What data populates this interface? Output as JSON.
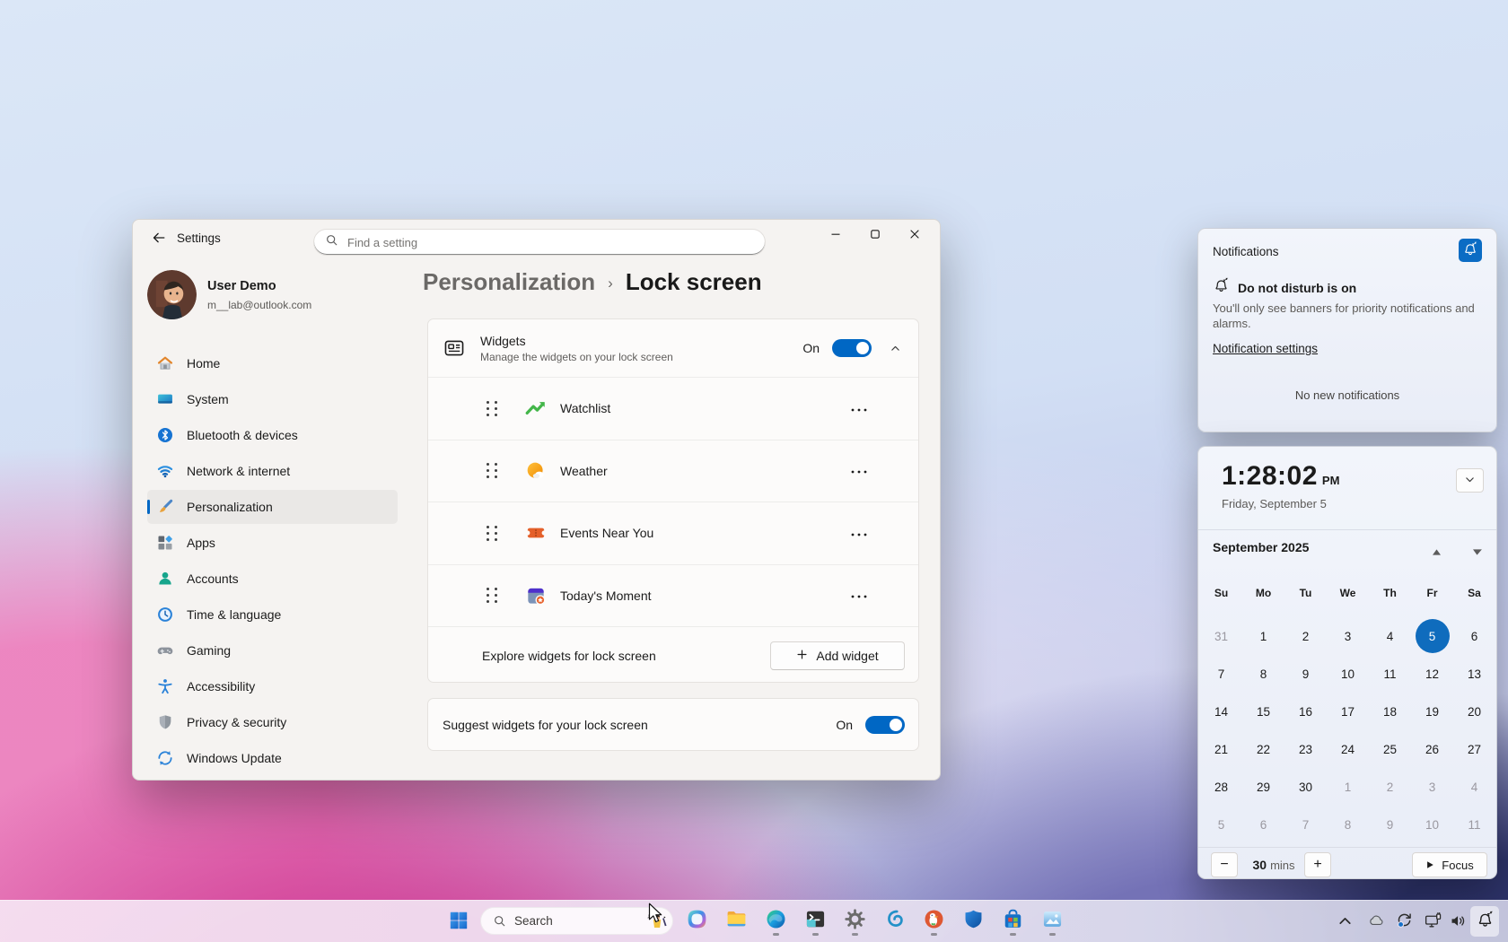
{
  "accent": "#0067c4",
  "settings_window": {
    "title": "Settings",
    "search_placeholder": "Find a setting",
    "window_controls": [
      {
        "name": "minimize-button",
        "icon": "minimize"
      },
      {
        "name": "maximize-button",
        "icon": "maximize"
      },
      {
        "name": "close-button",
        "icon": "close"
      }
    ],
    "user": {
      "name": "User Demo",
      "email": "m__lab@outlook.com"
    },
    "sidebar": [
      {
        "label": "Home",
        "icon": "home-icon"
      },
      {
        "label": "System",
        "icon": "system-icon"
      },
      {
        "label": "Bluetooth & devices",
        "icon": "bluetooth-icon"
      },
      {
        "label": "Network & internet",
        "icon": "network-icon"
      },
      {
        "label": "Personalization",
        "icon": "personalization-icon",
        "selected": true
      },
      {
        "label": "Apps",
        "icon": "apps-icon"
      },
      {
        "label": "Accounts",
        "icon": "accounts-icon"
      },
      {
        "label": "Time & language",
        "icon": "time-language-icon"
      },
      {
        "label": "Gaming",
        "icon": "gaming-icon"
      },
      {
        "label": "Accessibility",
        "icon": "accessibility-icon"
      },
      {
        "label": "Privacy & security",
        "icon": "privacy-icon"
      },
      {
        "label": "Windows Update",
        "icon": "windows-update-icon"
      }
    ],
    "breadcrumb": {
      "parent": "Personalization",
      "separator": "›",
      "current": "Lock screen"
    },
    "widgets": {
      "title": "Widgets",
      "subtitle": "Manage the widgets on your lock screen",
      "state": "On",
      "items": [
        {
          "label": "Watchlist",
          "icon": "watchlist-icon"
        },
        {
          "label": "Weather",
          "icon": "weather-icon"
        },
        {
          "label": "Events Near You",
          "icon": "events-icon"
        },
        {
          "label": "Today's Moment",
          "icon": "todays-moment-icon"
        }
      ],
      "explore_label": "Explore widgets for lock screen",
      "add_widget_label": "Add widget"
    },
    "suggest": {
      "label": "Suggest widgets for your lock screen",
      "state": "On"
    }
  },
  "notifications_panel": {
    "title": "Notifications",
    "dnd_title": "Do not disturb is on",
    "dnd_body": "You'll only see banners for priority notifications and alarms.",
    "settings_link": "Notification settings",
    "empty": "No new notifications"
  },
  "clock_panel": {
    "time": "1:28:02",
    "meridiem": "PM",
    "date": "Friday, September 5"
  },
  "calendar": {
    "month_label": "September 2025",
    "day_headers": [
      "Su",
      "Mo",
      "Tu",
      "We",
      "Th",
      "Fr",
      "Sa"
    ],
    "cells": [
      {
        "d": "31",
        "muted": true
      },
      {
        "d": "1"
      },
      {
        "d": "2"
      },
      {
        "d": "3"
      },
      {
        "d": "4"
      },
      {
        "d": "5",
        "selected": true
      },
      {
        "d": "6"
      },
      {
        "d": "7"
      },
      {
        "d": "8"
      },
      {
        "d": "9"
      },
      {
        "d": "10"
      },
      {
        "d": "11"
      },
      {
        "d": "12"
      },
      {
        "d": "13"
      },
      {
        "d": "14"
      },
      {
        "d": "15"
      },
      {
        "d": "16"
      },
      {
        "d": "17"
      },
      {
        "d": "18"
      },
      {
        "d": "19"
      },
      {
        "d": "20"
      },
      {
        "d": "21"
      },
      {
        "d": "22"
      },
      {
        "d": "23"
      },
      {
        "d": "24"
      },
      {
        "d": "25"
      },
      {
        "d": "26"
      },
      {
        "d": "27"
      },
      {
        "d": "28"
      },
      {
        "d": "29"
      },
      {
        "d": "30"
      },
      {
        "d": "1",
        "muted": true
      },
      {
        "d": "2",
        "muted": true
      },
      {
        "d": "3",
        "muted": true
      },
      {
        "d": "4",
        "muted": true
      },
      {
        "d": "5",
        "muted": true
      },
      {
        "d": "6",
        "muted": true
      },
      {
        "d": "7",
        "muted": true
      },
      {
        "d": "8",
        "muted": true
      },
      {
        "d": "9",
        "muted": true
      },
      {
        "d": "10",
        "muted": true
      },
      {
        "d": "11",
        "muted": true
      }
    ],
    "focus_bar": {
      "duration": "30",
      "unit": "mins",
      "button_label": "Focus"
    }
  },
  "taskbar": {
    "search_label": "Search",
    "pinned": [
      {
        "name": "copilot-button",
        "icon": "copilot-icon",
        "running": false
      },
      {
        "name": "file-explorer-button",
        "icon": "explorer-icon",
        "running": false
      },
      {
        "name": "edge-button",
        "icon": "edge-icon",
        "running": true
      },
      {
        "name": "terminal-button",
        "icon": "terminal-icon",
        "running": true
      },
      {
        "name": "settings-app-button",
        "icon": "gear-icon",
        "running": true
      },
      {
        "name": "shell-app-button",
        "icon": "spiral-icon",
        "running": false
      },
      {
        "name": "duckduckgo-button",
        "icon": "duckduckgo-icon",
        "running": true
      },
      {
        "name": "defender-button",
        "icon": "shield-icon",
        "running": false
      },
      {
        "name": "store-button",
        "icon": "store-icon",
        "running": true
      },
      {
        "name": "photos-button",
        "icon": "photos-icon",
        "running": true
      }
    ],
    "tray": [
      {
        "name": "tray-chevron-up-button",
        "icon": "chevron-up-tray"
      },
      {
        "name": "onedrive-tray-icon",
        "icon": "cloud-icon"
      },
      {
        "name": "update-tray-icon",
        "icon": "sync-icon"
      },
      {
        "name": "network-tray-icon",
        "icon": "monitor-icon"
      },
      {
        "name": "volume-tray-icon",
        "icon": "speaker-icon"
      }
    ]
  }
}
